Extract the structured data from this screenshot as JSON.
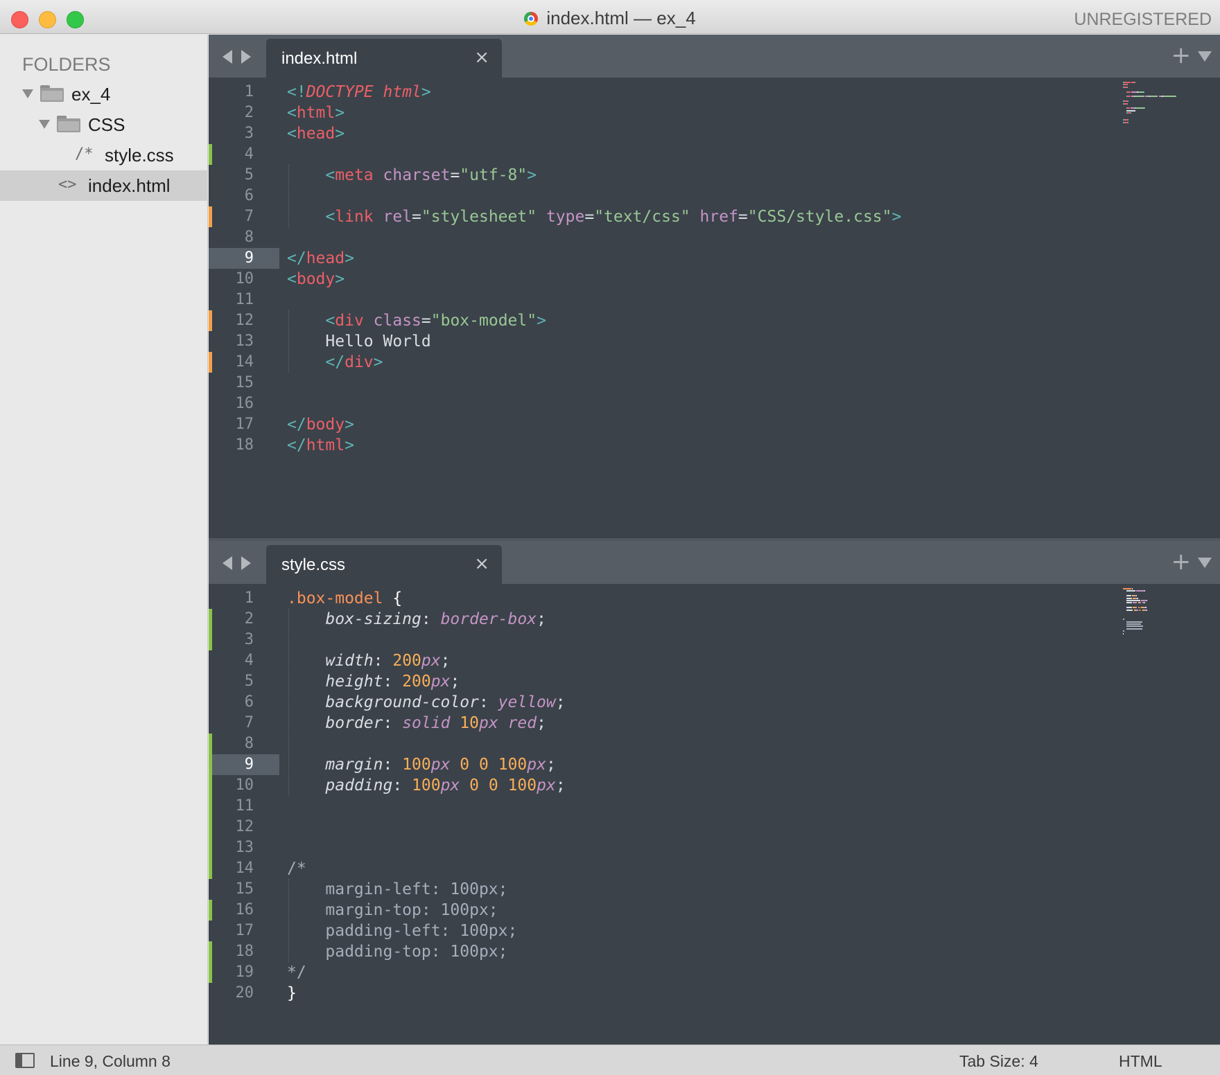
{
  "window": {
    "title": "index.html — ex_4",
    "registration": "UNREGISTERED"
  },
  "sidebar": {
    "header": "FOLDERS",
    "items": [
      {
        "label": "ex_4",
        "type": "folder",
        "expanded": true
      },
      {
        "label": "CSS",
        "type": "folder",
        "expanded": true
      },
      {
        "label": "style.css",
        "type": "file",
        "glyph": "/*"
      },
      {
        "label": "index.html",
        "type": "file",
        "glyph": "<>",
        "selected": true
      }
    ]
  },
  "panes": [
    {
      "tab_label": "index.html",
      "close_glyph": "×",
      "new_tab_glyph": "+",
      "current_line": 9,
      "line_numbers": [
        "1",
        "2",
        "3",
        "4",
        "5",
        "6",
        "7",
        "8",
        "9",
        "10",
        "11",
        "12",
        "13",
        "14",
        "15",
        "16",
        "17",
        "18"
      ],
      "gutter_marks": {
        "4": "green",
        "7": "orange",
        "12": "orange",
        "14": "orange"
      },
      "lines": [
        [
          [
            "<!",
            "c-punc"
          ],
          [
            "DOCTYPE",
            "c-tag-i"
          ],
          [
            " ",
            "c-text"
          ],
          [
            "html",
            "c-attr-i"
          ],
          [
            ">",
            "c-punc"
          ]
        ],
        [
          [
            "<",
            "c-punc"
          ],
          [
            "html",
            "c-tag"
          ],
          [
            ">",
            "c-punc"
          ]
        ],
        [
          [
            "<",
            "c-punc"
          ],
          [
            "head",
            "c-tag"
          ],
          [
            ">",
            "c-punc"
          ]
        ],
        [],
        [
          [
            "    ",
            "c-text"
          ],
          [
            "<",
            "c-punc"
          ],
          [
            "meta",
            "c-tag"
          ],
          [
            " ",
            "c-text"
          ],
          [
            "charset",
            "c-attr"
          ],
          [
            "=",
            "c-text"
          ],
          [
            "\"utf-8\"",
            "c-str"
          ],
          [
            ">",
            "c-punc"
          ]
        ],
        [],
        [
          [
            "    ",
            "c-text"
          ],
          [
            "<",
            "c-punc"
          ],
          [
            "link",
            "c-tag"
          ],
          [
            " ",
            "c-text"
          ],
          [
            "rel",
            "c-attr"
          ],
          [
            "=",
            "c-text"
          ],
          [
            "\"stylesheet\"",
            "c-str"
          ],
          [
            " ",
            "c-text"
          ],
          [
            "type",
            "c-attr"
          ],
          [
            "=",
            "c-text"
          ],
          [
            "\"text/css\"",
            "c-str"
          ],
          [
            " ",
            "c-text"
          ],
          [
            "href",
            "c-attr"
          ],
          [
            "=",
            "c-text"
          ],
          [
            "\"CSS/style.css\"",
            "c-str"
          ],
          [
            ">",
            "c-punc"
          ]
        ],
        [],
        [
          [
            "</",
            "c-punc"
          ],
          [
            "head",
            "c-tag"
          ],
          [
            ">",
            "c-punc"
          ]
        ],
        [
          [
            "<",
            "c-punc"
          ],
          [
            "body",
            "c-tag"
          ],
          [
            ">",
            "c-punc"
          ]
        ],
        [],
        [
          [
            "    ",
            "c-text"
          ],
          [
            "<",
            "c-punc"
          ],
          [
            "div",
            "c-tag"
          ],
          [
            " ",
            "c-text"
          ],
          [
            "class",
            "c-attr"
          ],
          [
            "=",
            "c-text"
          ],
          [
            "\"box-model\"",
            "c-str"
          ],
          [
            ">",
            "c-punc"
          ]
        ],
        [
          [
            "    Hello World",
            "c-text"
          ]
        ],
        [
          [
            "    ",
            "c-text"
          ],
          [
            "</",
            "c-punc"
          ],
          [
            "div",
            "c-tag"
          ],
          [
            ">",
            "c-punc"
          ]
        ],
        [],
        [],
        [
          [
            "</",
            "c-punc"
          ],
          [
            "body",
            "c-tag"
          ],
          [
            ">",
            "c-punc"
          ]
        ],
        [
          [
            "</",
            "c-punc"
          ],
          [
            "html",
            "c-tag"
          ],
          [
            ">",
            "c-punc"
          ]
        ]
      ]
    },
    {
      "tab_label": "style.css",
      "close_glyph": "×",
      "new_tab_glyph": "+",
      "current_line": 9,
      "line_numbers": [
        "1",
        "2",
        "3",
        "4",
        "5",
        "6",
        "7",
        "8",
        "9",
        "10",
        "11",
        "12",
        "13",
        "14",
        "15",
        "16",
        "17",
        "18",
        "19",
        "20"
      ],
      "gutter_marks": {
        "2": "green",
        "3": "green",
        "8": "green",
        "9": "green",
        "10": "green",
        "11": "green",
        "12": "green",
        "13": "green",
        "14": "green",
        "16": "green",
        "18": "green",
        "19": "green"
      },
      "lines": [
        [
          [
            ".box-model",
            "c-sel"
          ],
          [
            " ",
            "c-text"
          ],
          [
            "{",
            "c-brace"
          ]
        ],
        [
          [
            "    ",
            "c-text"
          ],
          [
            "box-sizing",
            "c-prop"
          ],
          [
            ": ",
            "c-text"
          ],
          [
            "border-box",
            "c-val"
          ],
          [
            ";",
            "c-text"
          ]
        ],
        [],
        [
          [
            "    ",
            "c-text"
          ],
          [
            "width",
            "c-prop"
          ],
          [
            ": ",
            "c-text"
          ],
          [
            "200",
            "c-num"
          ],
          [
            "px",
            "c-unit"
          ],
          [
            ";",
            "c-text"
          ]
        ],
        [
          [
            "    ",
            "c-text"
          ],
          [
            "height",
            "c-prop"
          ],
          [
            ": ",
            "c-text"
          ],
          [
            "200",
            "c-num"
          ],
          [
            "px",
            "c-unit"
          ],
          [
            ";",
            "c-text"
          ]
        ],
        [
          [
            "    ",
            "c-text"
          ],
          [
            "background-color",
            "c-prop"
          ],
          [
            ": ",
            "c-text"
          ],
          [
            "yellow",
            "c-val"
          ],
          [
            ";",
            "c-text"
          ]
        ],
        [
          [
            "    ",
            "c-text"
          ],
          [
            "border",
            "c-prop"
          ],
          [
            ": ",
            "c-text"
          ],
          [
            "solid",
            "c-val"
          ],
          [
            " ",
            "c-text"
          ],
          [
            "10",
            "c-num"
          ],
          [
            "px",
            "c-unit"
          ],
          [
            " ",
            "c-text"
          ],
          [
            "red",
            "c-val"
          ],
          [
            ";",
            "c-text"
          ]
        ],
        [],
        [
          [
            "    ",
            "c-text"
          ],
          [
            "margin",
            "c-prop"
          ],
          [
            ": ",
            "c-text"
          ],
          [
            "100",
            "c-num"
          ],
          [
            "px",
            "c-unit"
          ],
          [
            " ",
            "c-text"
          ],
          [
            "0",
            "c-num"
          ],
          [
            " ",
            "c-text"
          ],
          [
            "0",
            "c-num"
          ],
          [
            " ",
            "c-text"
          ],
          [
            "100",
            "c-num"
          ],
          [
            "px",
            "c-unit"
          ],
          [
            ";",
            "c-text"
          ]
        ],
        [
          [
            "    ",
            "c-text"
          ],
          [
            "padding",
            "c-prop"
          ],
          [
            ": ",
            "c-text"
          ],
          [
            "100",
            "c-num"
          ],
          [
            "px",
            "c-unit"
          ],
          [
            " ",
            "c-text"
          ],
          [
            "0",
            "c-num"
          ],
          [
            " ",
            "c-text"
          ],
          [
            "0",
            "c-num"
          ],
          [
            " ",
            "c-text"
          ],
          [
            "100",
            "c-num"
          ],
          [
            "px",
            "c-unit"
          ],
          [
            ";",
            "c-text"
          ]
        ],
        [],
        [],
        [],
        [
          [
            "/*",
            "c-comment"
          ]
        ],
        [
          [
            "    margin-left: 100px;",
            "c-comment"
          ]
        ],
        [
          [
            "    margin-top: 100px;",
            "c-comment"
          ]
        ],
        [
          [
            "    padding-left: 100px;",
            "c-comment"
          ]
        ],
        [
          [
            "    padding-top: 100px;",
            "c-comment"
          ]
        ],
        [
          [
            "*/",
            "c-comment"
          ]
        ],
        [
          [
            "}",
            "c-brace"
          ]
        ]
      ]
    }
  ],
  "statusbar": {
    "position": "Line 9, Column 8",
    "tab_size": "Tab Size: 4",
    "syntax": "HTML"
  },
  "icons": [
    "close-window-icon",
    "minimize-window-icon",
    "zoom-window-icon",
    "chrome-file-icon",
    "folder-icon",
    "disclosure-triangle-icon",
    "back-arrow-icon",
    "forward-arrow-icon",
    "tab-close-icon",
    "new-tab-plus-icon",
    "tab-dropdown-icon",
    "sidebar-toggle-icon"
  ]
}
